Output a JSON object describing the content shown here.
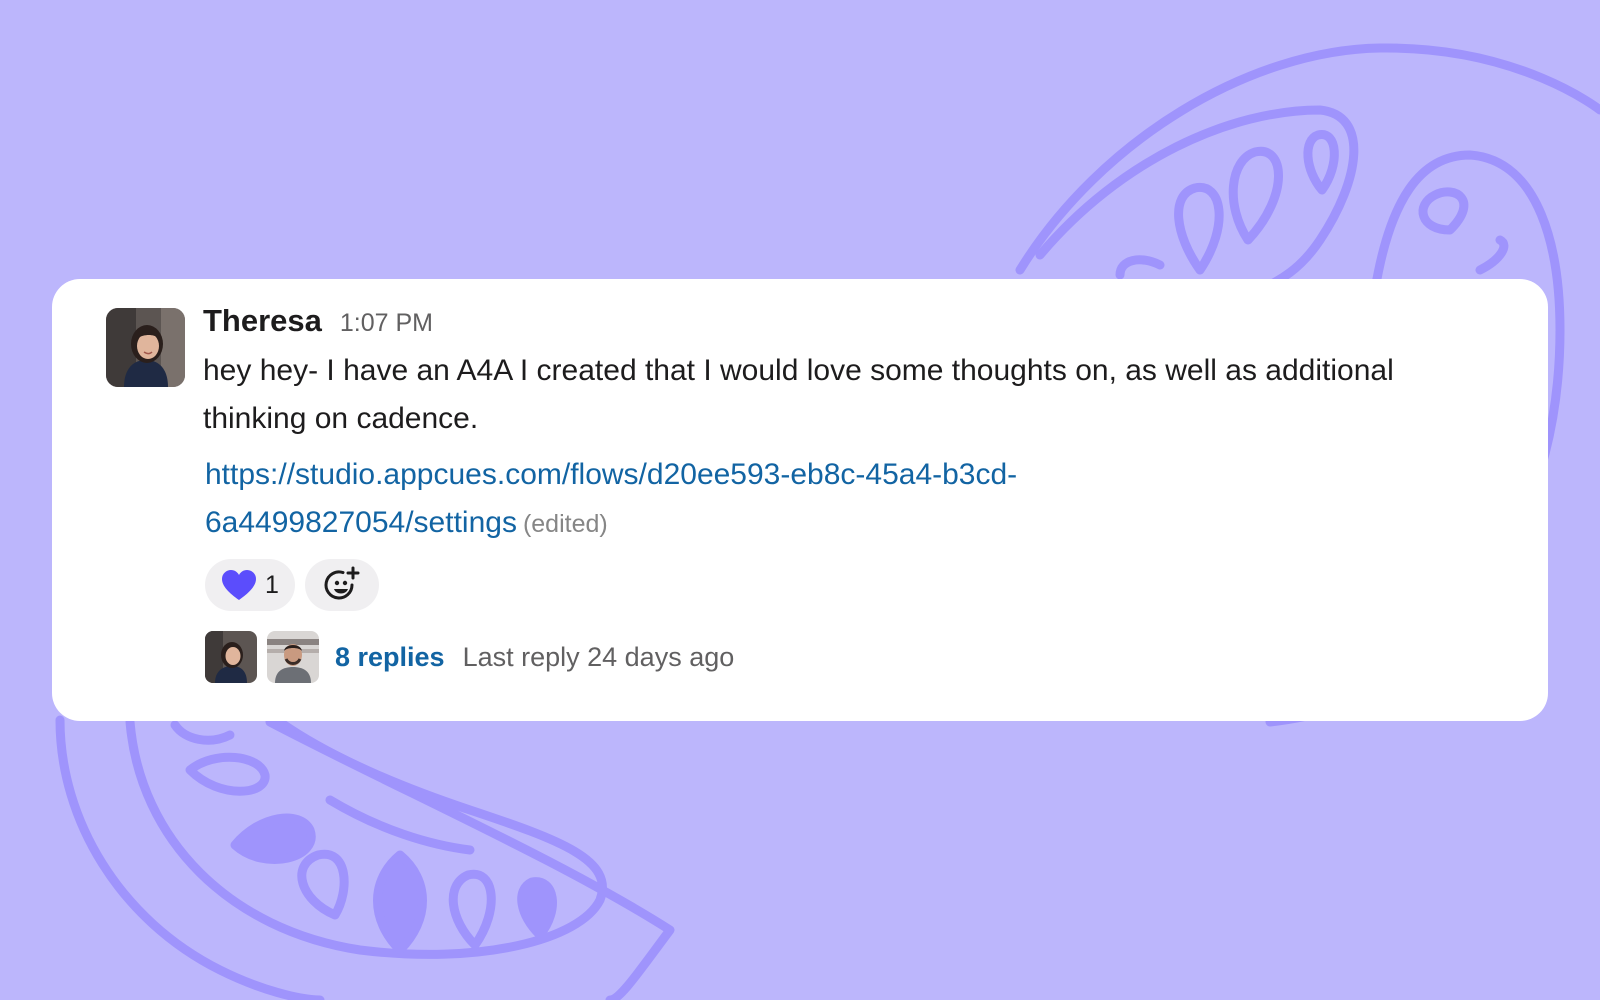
{
  "colors": {
    "background": "#bcb6fc",
    "decoration": "#9f94fc",
    "card": "#ffffff",
    "link": "#1264a3",
    "heart": "#5b4dfc"
  },
  "message": {
    "sender": "Theresa",
    "timestamp": "1:07 PM",
    "text": "hey hey- I have an A4A I created that I would love some thoughts on, as well as additional thinking on cadence.",
    "link": "https://studio.appcues.com/flows/d20ee593-eb8c-45a4-b3cd-6a4499827054/settings",
    "edited_label": "(edited)",
    "avatar_icon": "user-avatar-photo"
  },
  "reactions": [
    {
      "emoji_icon": "purple-heart-icon",
      "count": "1"
    }
  ],
  "add_reaction_icon": "add-emoji-icon",
  "thread": {
    "participants": [
      "participant-avatar-theresa",
      "participant-avatar-man"
    ],
    "replies_label": "8 replies",
    "last_reply_label": "Last reply 24 days ago"
  }
}
